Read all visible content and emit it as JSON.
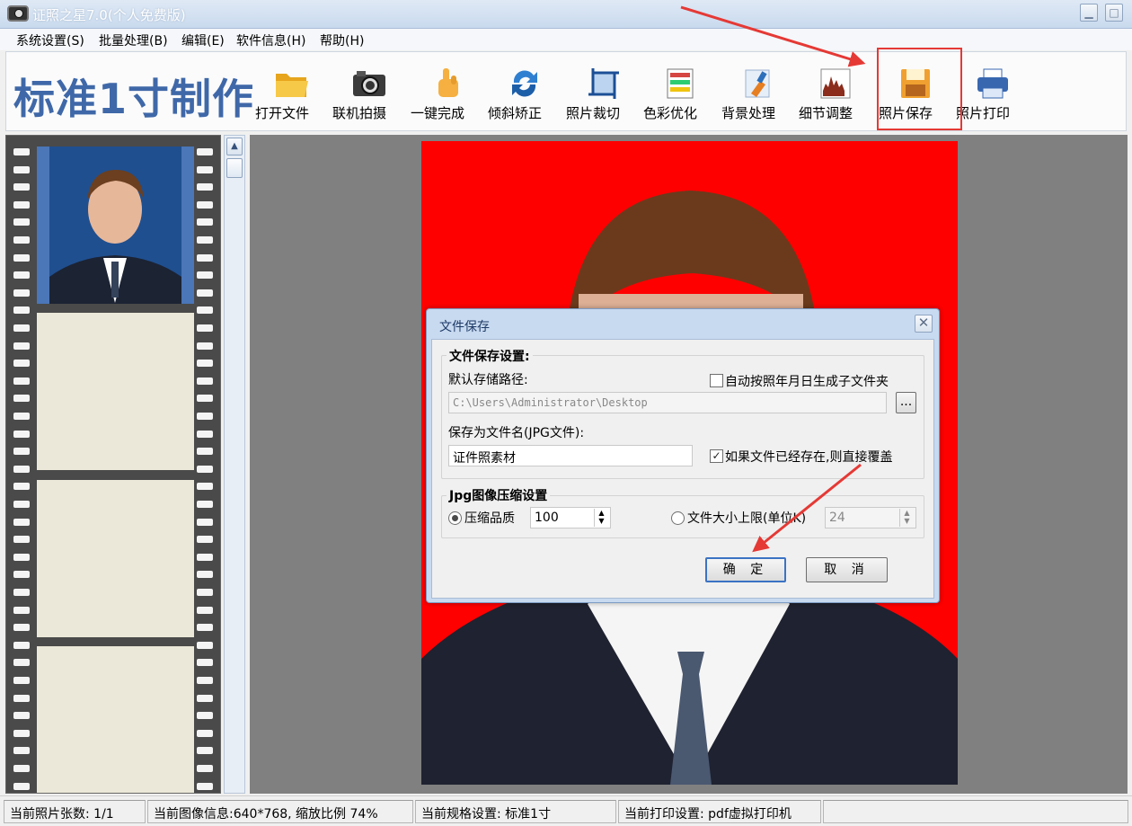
{
  "window": {
    "title": "证照之星7.0(个人免费版)"
  },
  "menu": [
    "系统设置(S)",
    "批量处理(B)",
    "编辑(E)",
    "软件信息(H)",
    "帮助(H)"
  ],
  "brand": "标准1寸制作",
  "toolbar": [
    {
      "label": "打开文件",
      "icon": "folder-icon"
    },
    {
      "label": "联机拍摄",
      "icon": "camera-icon"
    },
    {
      "label": "一键完成",
      "icon": "hand-pointer-icon"
    },
    {
      "label": "倾斜矫正",
      "icon": "rotate-icon"
    },
    {
      "label": "照片裁切",
      "icon": "crop-icon"
    },
    {
      "label": "色彩优化",
      "icon": "color-palette-icon"
    },
    {
      "label": "背景处理",
      "icon": "brush-icon"
    },
    {
      "label": "细节调整",
      "icon": "histogram-icon"
    },
    {
      "label": "照片保存",
      "icon": "floppy-disk-icon"
    },
    {
      "label": "照片打印",
      "icon": "printer-icon"
    }
  ],
  "dialog": {
    "title": "文件保存",
    "save_group": "文件保存设置:",
    "path_label": "默认存储路径:",
    "path_value": "C:\\Users\\Administrator\\Desktop",
    "browse_label": "...",
    "auto_subfolder_label": "自动按照年月日生成子文件夹",
    "auto_subfolder_checked": false,
    "filename_label": "保存为文件名(JPG文件):",
    "filename_value": "证件照素材",
    "overwrite_label": "如果文件已经存在,则直接覆盖",
    "overwrite_checked": true,
    "jpg_group": "Jpg图像压缩设置",
    "quality_label": "压缩品质",
    "quality_value": "100",
    "filesize_label": "文件大小上限(单位K)",
    "filesize_value": "24",
    "ok_label": "确 定",
    "cancel_label": "取 消"
  },
  "status": {
    "count": "当前照片张数: 1/1",
    "image_info": "当前图像信息:640*768, 缩放比例 74%",
    "spec": "当前规格设置: 标准1寸",
    "print": "当前打印设置: pdf虚拟打印机"
  },
  "colors": {
    "accent_blue": "#3f68a8",
    "annotation_red": "#e53935",
    "photo_background": "#ff0000"
  }
}
